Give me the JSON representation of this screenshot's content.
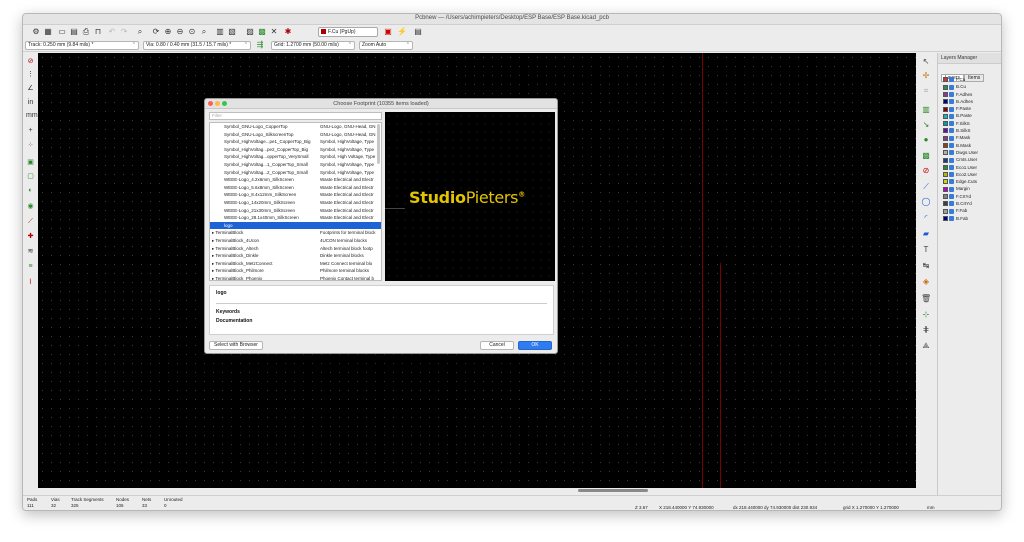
{
  "window": {
    "title": "Pcbnew — /Users/achimpieters/Desktop/ESP Base/ESP Base.kicad_pcb"
  },
  "toolbar": {
    "active_layer": "F.Cu (PgUp)",
    "track": "Track: 0.250 mm (9.84 mils) *",
    "via": "Via: 0.80 / 0.40 mm (31.5 / 15.7 mils) *",
    "grid": "Grid: 1.2700 mm (50.00 mils)",
    "zoom": "Zoom Auto",
    "colors": {
      "layer_fcu": "#aa0000"
    }
  },
  "dialog": {
    "title": "Choose Footprint (10355 items loaded)",
    "filter_placeholder": "Filter",
    "rows": [
      {
        "name": "Symbol_GNU-Logo_CopperTop",
        "desc": "GNU-Logo, GNU-Head, GN",
        "type": "item"
      },
      {
        "name": "Symbol_GNU-Logo_SilkscreenTop",
        "desc": "GNU-Logo, GNU-Head, GN",
        "type": "item"
      },
      {
        "name": "Symbol_HighVoltage...pe1_CopperTop_Big",
        "desc": "Symbol, HighVoltage, Type",
        "type": "item"
      },
      {
        "name": "Symbol_HighVoltag...pe2_CopperTop_Big",
        "desc": "Symbol, HighVoltage, Type",
        "type": "item"
      },
      {
        "name": "Symbol_HighVoltag...opperTop_VerySmall",
        "desc": "Symbol, High Voltage, Type",
        "type": "item"
      },
      {
        "name": "Symbol_HighVoltag...1_CopperTop_Small",
        "desc": "Symbol, HighVoltage, Type",
        "type": "item"
      },
      {
        "name": "Symbol_HighVoltag...2_CopperTop_Small",
        "desc": "Symbol, HighVoltage, Type",
        "type": "item"
      },
      {
        "name": "WEEE-Logo_4.2x6mm_SilkScreen",
        "desc": "Waste Electrical and Electr",
        "type": "item"
      },
      {
        "name": "WEEE-Logo_5.6x8mm_SilkScreen",
        "desc": "Waste Electrical and Electr",
        "type": "item"
      },
      {
        "name": "WEEE-Logo_8.4x12mm_SilkScreen",
        "desc": "Waste Electrical and Electr",
        "type": "item"
      },
      {
        "name": "WEEE-Logo_14x20mm_SilkScreen",
        "desc": "Waste Electrical and Electr",
        "type": "item"
      },
      {
        "name": "WEEE-Logo_21x30mm_SilkScreen",
        "desc": "Waste Electrical and Electr",
        "type": "item"
      },
      {
        "name": "WEEE-Logo_28.1x40mm_SilkScreen",
        "desc": "Waste Electrical and Electr",
        "type": "item"
      },
      {
        "name": "logo",
        "desc": "",
        "type": "selected"
      },
      {
        "name": "▸ TerminalBlock",
        "desc": "Footprints for terminal block",
        "type": "lib"
      },
      {
        "name": "▸ TerminalBlock_4Ucon",
        "desc": "4UCON terminal blocks",
        "type": "lib"
      },
      {
        "name": "▸ TerminalBlock_Altech",
        "desc": "Altech terminal block footp",
        "type": "lib"
      },
      {
        "name": "▸ TerminalBlock_Dinkle",
        "desc": "Dinkle terminal blocks",
        "type": "lib"
      },
      {
        "name": "▸ TerminalBlock_MetzConnect",
        "desc": "Metz Connect terminal blo",
        "type": "lib"
      },
      {
        "name": "▸ TerminalBlock_Philmore",
        "desc": "Philmore terminal blocks",
        "type": "lib"
      },
      {
        "name": "▸ TerminalBlock_Phoenix",
        "desc": "Phoenix Contact terminal b",
        "type": "lib"
      }
    ],
    "preview_logo_bold": "Studio",
    "preview_logo_rest": "Pieters",
    "preview_logo_mark": "®",
    "selected_name": "logo",
    "keywords_label": "Keywords",
    "documentation_label": "Documentation",
    "select_with_browser": "Select with Browser",
    "cancel": "Cancel",
    "ok": "OK"
  },
  "layers_manager": {
    "title": "Layers Manager",
    "tabs": [
      "Layers",
      "Items"
    ],
    "layers": [
      {
        "name": "F.Cu",
        "color": "#c83434"
      },
      {
        "name": "B.Cu",
        "color": "#2e8b57"
      },
      {
        "name": "F.Adhes",
        "color": "#8b3a8b"
      },
      {
        "name": "B.Adhes",
        "color": "#00008b"
      },
      {
        "name": "F.Paste",
        "color": "#8b0000"
      },
      {
        "name": "B.Paste",
        "color": "#20b2aa"
      },
      {
        "name": "F.SilkS",
        "color": "#00a0a0"
      },
      {
        "name": "B.SilkS",
        "color": "#6a0dad"
      },
      {
        "name": "F.Mask",
        "color": "#8b3a8b"
      },
      {
        "name": "B.Mask",
        "color": "#8b4513"
      },
      {
        "name": "Dwgs.User",
        "color": "#b0b0b0"
      },
      {
        "name": "Cmts.User",
        "color": "#1e3a8b"
      },
      {
        "name": "Eco1.User",
        "color": "#2e8b2e"
      },
      {
        "name": "Eco2.User",
        "color": "#b8b800"
      },
      {
        "name": "Edge.Cuts",
        "color": "#d4d400"
      },
      {
        "name": "Margin",
        "color": "#c000c0"
      },
      {
        "name": "F.CrtYd",
        "color": "#808080"
      },
      {
        "name": "B.CrtYd",
        "color": "#404040"
      },
      {
        "name": "F.Fab",
        "color": "#a0a0a0"
      },
      {
        "name": "B.Fab",
        "color": "#00008b"
      }
    ]
  },
  "status": {
    "pads_label": "Pads",
    "pads": "111",
    "vias_label": "Vias",
    "vias": "32",
    "track_label": "Track Segments",
    "track": "325",
    "nodes_label": "Nodes",
    "nodes": "106",
    "nets_label": "Nets",
    "nets": "33",
    "unrouted_label": "Unrouted",
    "unrouted": "0",
    "zoom": "Z 3.67",
    "xy": "X 218.440000  Y 74.930000",
    "dxy": "dx 218.440000  dy 74.930000  dist 230.934",
    "grid": "grid X 1.270000  Y 1.270000",
    "units": "mm"
  }
}
